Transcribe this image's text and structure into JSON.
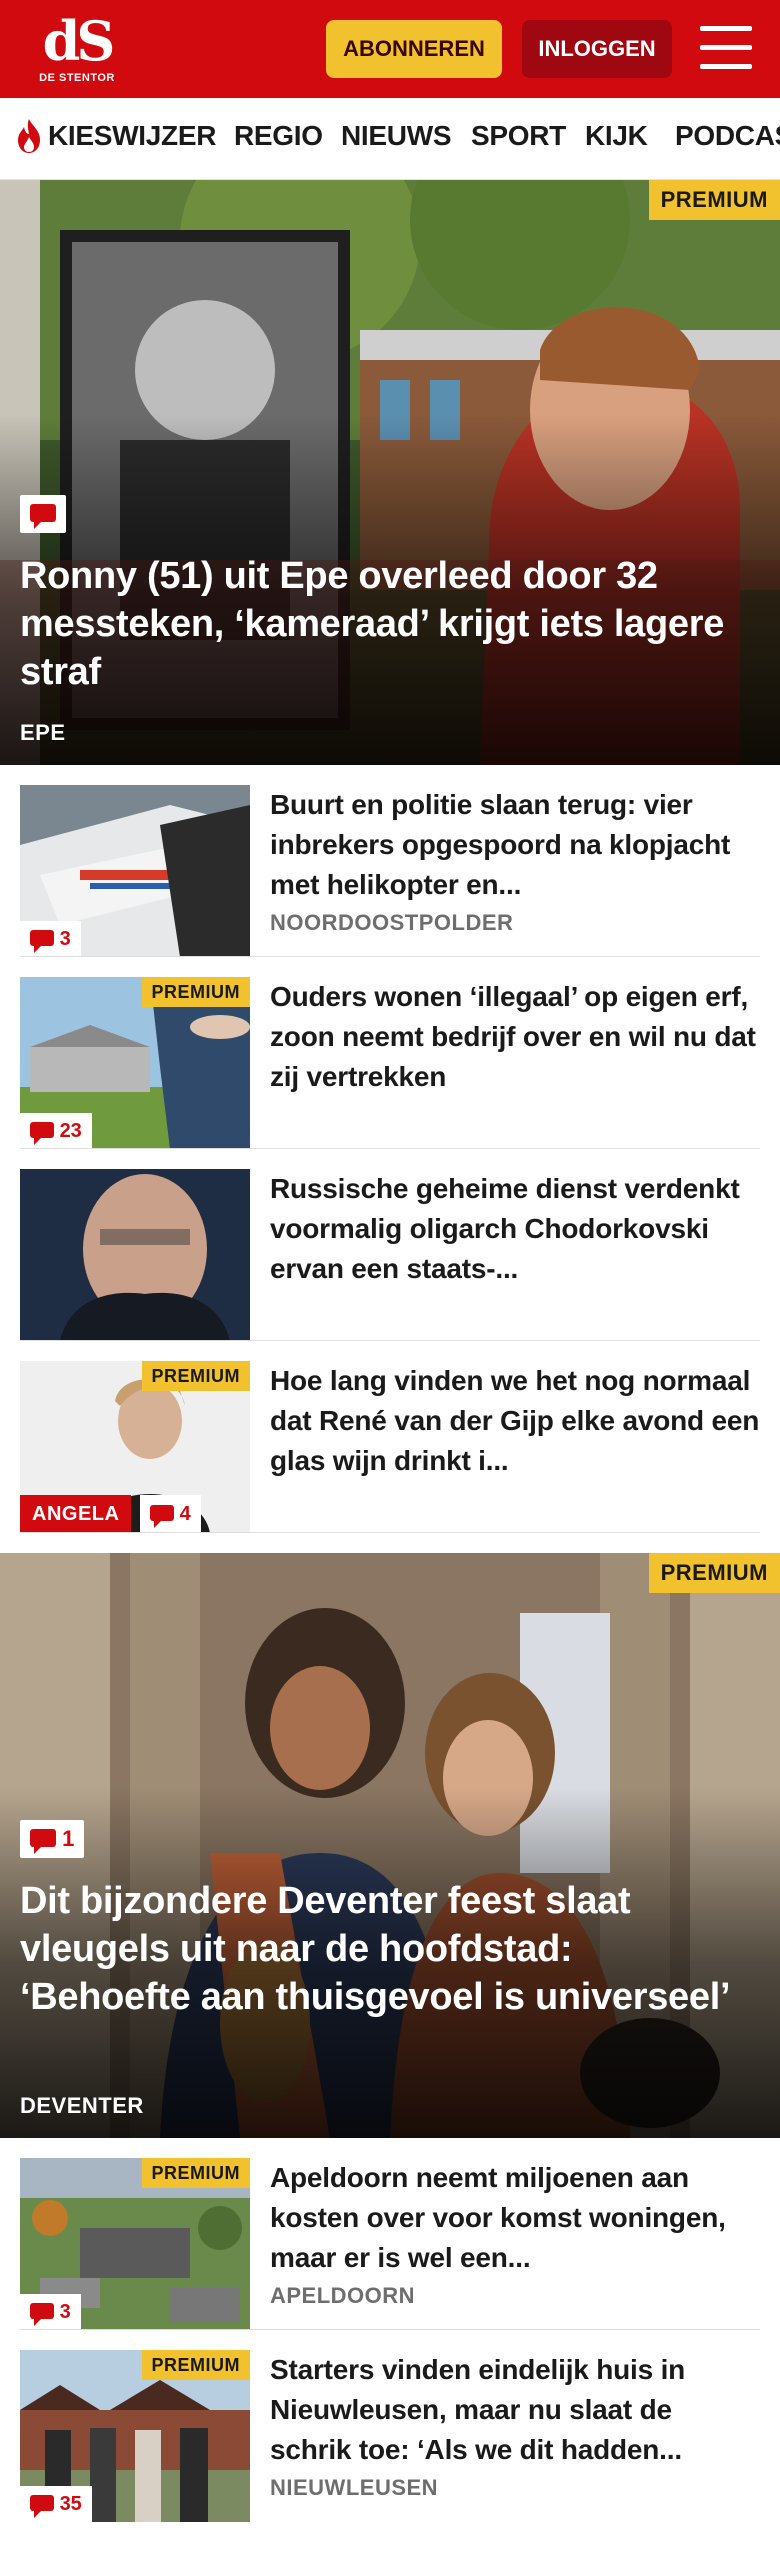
{
  "header": {
    "logo_mark": "dS",
    "logo_sub": "DE STENTOR",
    "subscribe_label": "ABONNEREN",
    "login_label": "INLOGGEN",
    "brand_color": "#d10a10",
    "accent_color": "#f2c12e"
  },
  "nav": {
    "items": [
      "KIESWIJZER",
      "REGIO",
      "NIEUWS",
      "SPORT",
      "KIJK",
      "PODCAST"
    ]
  },
  "hero1": {
    "premium_label": "PREMIUM",
    "title": "Ronny (51) uit Epe overleed door 32 messteken, ‘kameraad’ krijgt iets lagere straf",
    "location": "EPE"
  },
  "articles": [
    {
      "title": "Buurt en politie slaan terug: vier inbrekers opgespoord na klopjacht met helikopter en...",
      "location": "NOORDOOSTPOLDER",
      "comments": "3"
    },
    {
      "premium_label": "PREMIUM",
      "title": "Ouders wonen ‘illegaal’ op eigen erf, zoon neemt bedrijf over en wil nu dat zij vertrekken",
      "comments": "23"
    },
    {
      "title": "Russische geheime dienst verdenkt voormalig oligarch Chodorkovski ervan een staats-..."
    },
    {
      "premium_label": "PREMIUM",
      "title": "Hoe lang vinden we het nog normaal dat René van der Gijp elke avond een glas wijn drinkt i...",
      "author": "ANGELA",
      "comments": "4"
    }
  ],
  "hero2": {
    "premium_label": "PREMIUM",
    "comments": "1",
    "title": "Dit bijzondere Deventer feest slaat vleugels uit naar de hoofdstad: ‘Behoefte aan thuisgevoel is universeel’",
    "location": "DEVENTER"
  },
  "articles2": [
    {
      "premium_label": "PREMIUM",
      "title": "Apeldoorn neemt miljoenen aan kosten over voor komst woningen, maar er is wel een...",
      "location": "APELDOORN",
      "comments": "3"
    },
    {
      "premium_label": "PREMIUM",
      "title": "Starters vinden eindelijk huis in Nieuwleusen, maar nu slaat de schrik toe: ‘Als we dit hadden...",
      "location": "NIEUWLEUSEN",
      "comments": "35"
    }
  ]
}
